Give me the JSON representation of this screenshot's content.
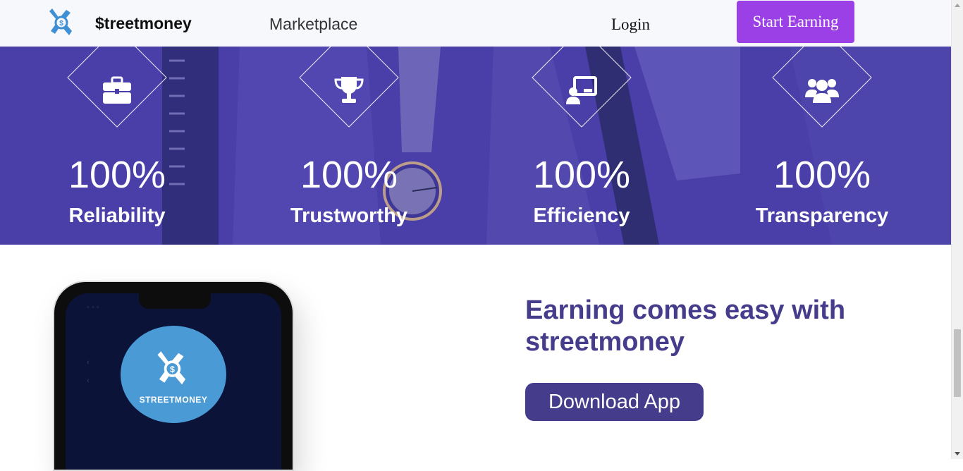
{
  "navbar": {
    "logo_icon": "streetmoney-logo-icon",
    "brand": "$treetmoney",
    "links": [
      {
        "label": "Marketplace"
      }
    ],
    "login_label": "Login",
    "cta_label": "Start Earning"
  },
  "stats": [
    {
      "icon": "briefcase-icon",
      "value": "100%",
      "label": "Reliability"
    },
    {
      "icon": "trophy-icon",
      "value": "100%",
      "label": "Trustworthy"
    },
    {
      "icon": "chalkboard-teacher-icon",
      "value": "100%",
      "label": "Efficiency"
    },
    {
      "icon": "users-icon",
      "value": "100%",
      "label": "Transparency"
    }
  ],
  "promo": {
    "headline": "Earning comes easy with streetmoney",
    "download_label": "Download App",
    "phone_app_name": "STREETMONEY"
  },
  "colors": {
    "nav_bg": "#f7f8fc",
    "cta": "#9b3fe6",
    "band": "#4a3fa8",
    "brand_purple": "#463c8c",
    "app_circle": "#4a9ad6"
  }
}
